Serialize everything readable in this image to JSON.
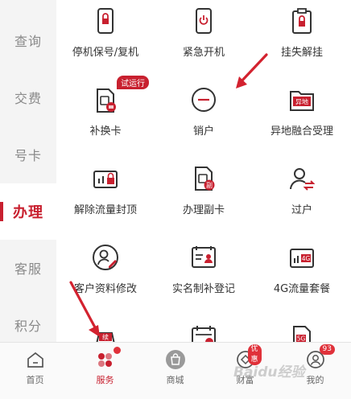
{
  "sidebar": {
    "items": [
      {
        "label": "查询"
      },
      {
        "label": "交费"
      },
      {
        "label": "号卡"
      },
      {
        "label": "办理"
      },
      {
        "label": "客服"
      },
      {
        "label": "积分"
      }
    ],
    "active": "办理"
  },
  "grid": {
    "items": [
      {
        "label": "停机保号/复机",
        "icon": "phone-lock-icon"
      },
      {
        "label": "紧急开机",
        "icon": "phone-power-icon"
      },
      {
        "label": "挂失解挂",
        "icon": "clipboard-lock-icon"
      },
      {
        "label": "补换卡",
        "icon": "sim-swap-icon",
        "badge": "试运行"
      },
      {
        "label": "销户",
        "icon": "minus-circle-icon"
      },
      {
        "label": "异地融合受理",
        "icon": "folder-remote-icon",
        "icon_text": "异地"
      },
      {
        "label": "解除流量封顶",
        "icon": "data-limit-icon"
      },
      {
        "label": "办理副卡",
        "icon": "sim-secondary-icon",
        "icon_text": "副"
      },
      {
        "label": "过户",
        "icon": "user-transfer-icon"
      },
      {
        "label": "客户资料修改",
        "icon": "user-edit-icon"
      },
      {
        "label": "实名制补登记",
        "icon": "id-card-icon"
      },
      {
        "label": "4G流量套餐",
        "icon": "data-4g-icon",
        "icon_text": "4G"
      },
      {
        "label": "",
        "icon": "renew-icon",
        "icon_text": "续"
      },
      {
        "label": "",
        "icon": "calendar-icon"
      },
      {
        "label": "",
        "icon": "5g-card-icon",
        "icon_text": "5G"
      }
    ]
  },
  "tabbar": {
    "items": [
      {
        "label": "首页",
        "icon": "home-icon"
      },
      {
        "label": "服务",
        "icon": "service-icon"
      },
      {
        "label": "商城",
        "icon": "shop-bag-icon"
      },
      {
        "label": "财富",
        "icon": "wealth-icon",
        "badge": "优惠"
      },
      {
        "label": "我的",
        "icon": "profile-icon",
        "badge": "93"
      }
    ],
    "active": "服务"
  },
  "watermark": "Baidu经验",
  "colors": {
    "accent": "#c8202f",
    "sidebar_bg": "#f4f4f4"
  }
}
